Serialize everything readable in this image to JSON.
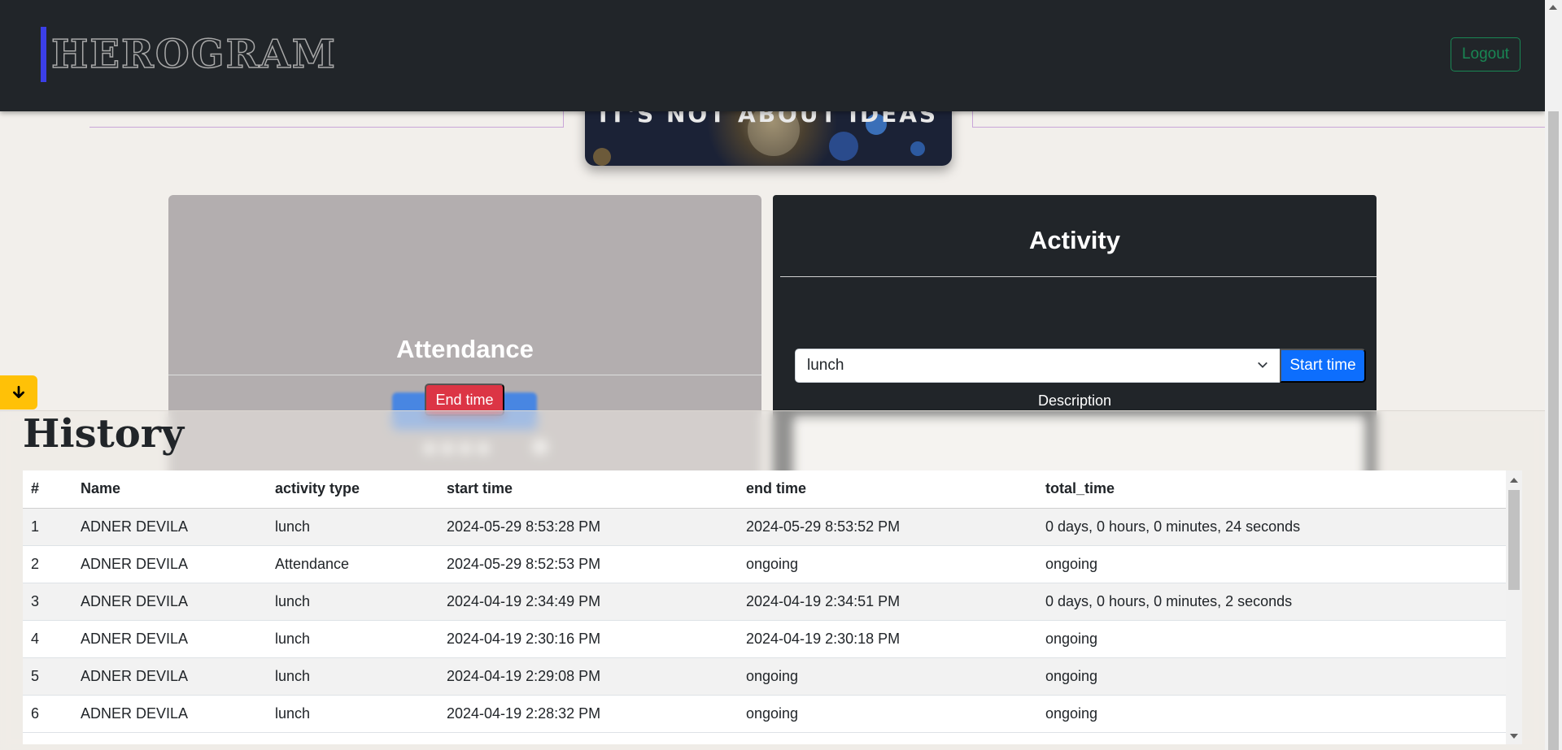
{
  "navbar": {
    "brand": "HEROGRAM",
    "logout_label": "Logout"
  },
  "banner": {
    "text": "IT'S NOT ABOUT IDEAS"
  },
  "attendance": {
    "title": "Attendance",
    "end_time_label": "End time"
  },
  "activity": {
    "title": "Activity",
    "selected_activity": "lunch",
    "start_time_label": "Start time",
    "description_label": "Description"
  },
  "history": {
    "title": "History",
    "columns": [
      "#",
      "Name",
      "activity type",
      "start time",
      "end time",
      "total_time"
    ],
    "rows": [
      [
        "1",
        "ADNER DEVILA",
        "lunch",
        "2024-05-29 8:53:28 PM",
        "2024-05-29 8:53:52 PM",
        "0 days, 0 hours, 0 minutes, 24 seconds"
      ],
      [
        "2",
        "ADNER DEVILA",
        "Attendance",
        "2024-05-29 8:52:53 PM",
        "ongoing",
        "ongoing"
      ],
      [
        "3",
        "ADNER DEVILA",
        "lunch",
        "2024-04-19 2:34:49 PM",
        "2024-04-19 2:34:51 PM",
        "0 days, 0 hours, 0 minutes, 2 seconds"
      ],
      [
        "4",
        "ADNER DEVILA",
        "lunch",
        "2024-04-19 2:30:16 PM",
        "2024-04-19 2:30:18 PM",
        "ongoing"
      ],
      [
        "5",
        "ADNER DEVILA",
        "lunch",
        "2024-04-19 2:29:08 PM",
        "ongoing",
        "ongoing"
      ],
      [
        "6",
        "ADNER DEVILA",
        "lunch",
        "2024-04-19 2:28:32 PM",
        "ongoing",
        "ongoing"
      ]
    ]
  },
  "colors": {
    "navbar_bg": "#212529",
    "brand_accent": "#3b3fe8",
    "logout_green": "#198754",
    "end_time_red": "#dc3545",
    "start_time_blue": "#0d6efd",
    "scroll_button_yellow": "#ffc107"
  },
  "icons": {
    "scroll_down": "arrow-down-icon",
    "select_chevron": "chevron-down-icon"
  }
}
